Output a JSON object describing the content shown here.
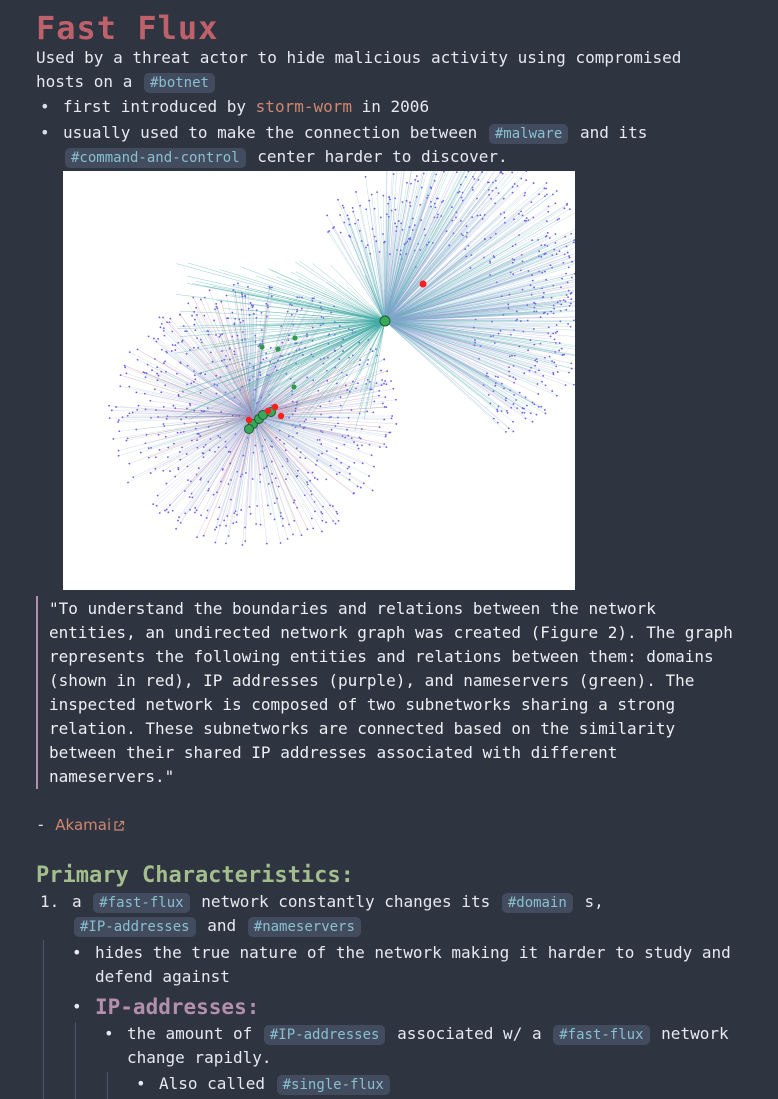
{
  "title": "Fast Flux",
  "intro": {
    "text": "Used by a threat actor to hide malicious activity using compromised hosts on a",
    "tag": "#botnet"
  },
  "bullets": [
    {
      "pre": "first introduced by",
      "link": "storm-worm",
      "post": "in 2006"
    },
    {
      "pre": "usually used to make the connection between",
      "tag1": "#malware",
      "mid": "and its",
      "tag2": "#command-and-control",
      "post": "center harder to discover."
    }
  ],
  "quote": "\"To understand the boundaries and relations between the network entities, an undirected network graph was created (Figure 2). The graph represents the following entities and relations between them: domains (shown in red), IP addresses (purple), and nameservers (green). The inspected network is composed of two subnetworks sharing a strong relation. These subnetworks are connected based on the similarity between their shared IP addresses associated with different nameservers.\"",
  "source": {
    "dash": "-",
    "link": "Akamai"
  },
  "section_title": "Primary Characteristics:",
  "list": {
    "number": "1.",
    "pre": "a",
    "tag1": "#fast-flux",
    "mid": "network constantly changes its",
    "tag2": "#domain",
    "sep": "s,",
    "tag3": "#IP-addresses",
    "and": "and",
    "tag4": "#nameservers",
    "sub1": "hides the true nature of the network making it harder to study and defend against",
    "sub_heading": "IP-addresses:",
    "sub2_pre": "the amount of",
    "sub2_tag1": "#IP-addresses",
    "sub2_mid": "associated w/ a",
    "sub2_tag2": "#fast-flux",
    "sub2_post": "network change rapidly.",
    "sub3_pre": "Also called",
    "sub3_tag": "#single-flux"
  },
  "colors": {
    "background": "#2e3440",
    "title": "#bf616a",
    "tag_bg": "#434c5e",
    "tag_fg": "#88c0d0",
    "link": "#d08770",
    "section": "#a3be8c",
    "subheading": "#b48ead"
  }
}
